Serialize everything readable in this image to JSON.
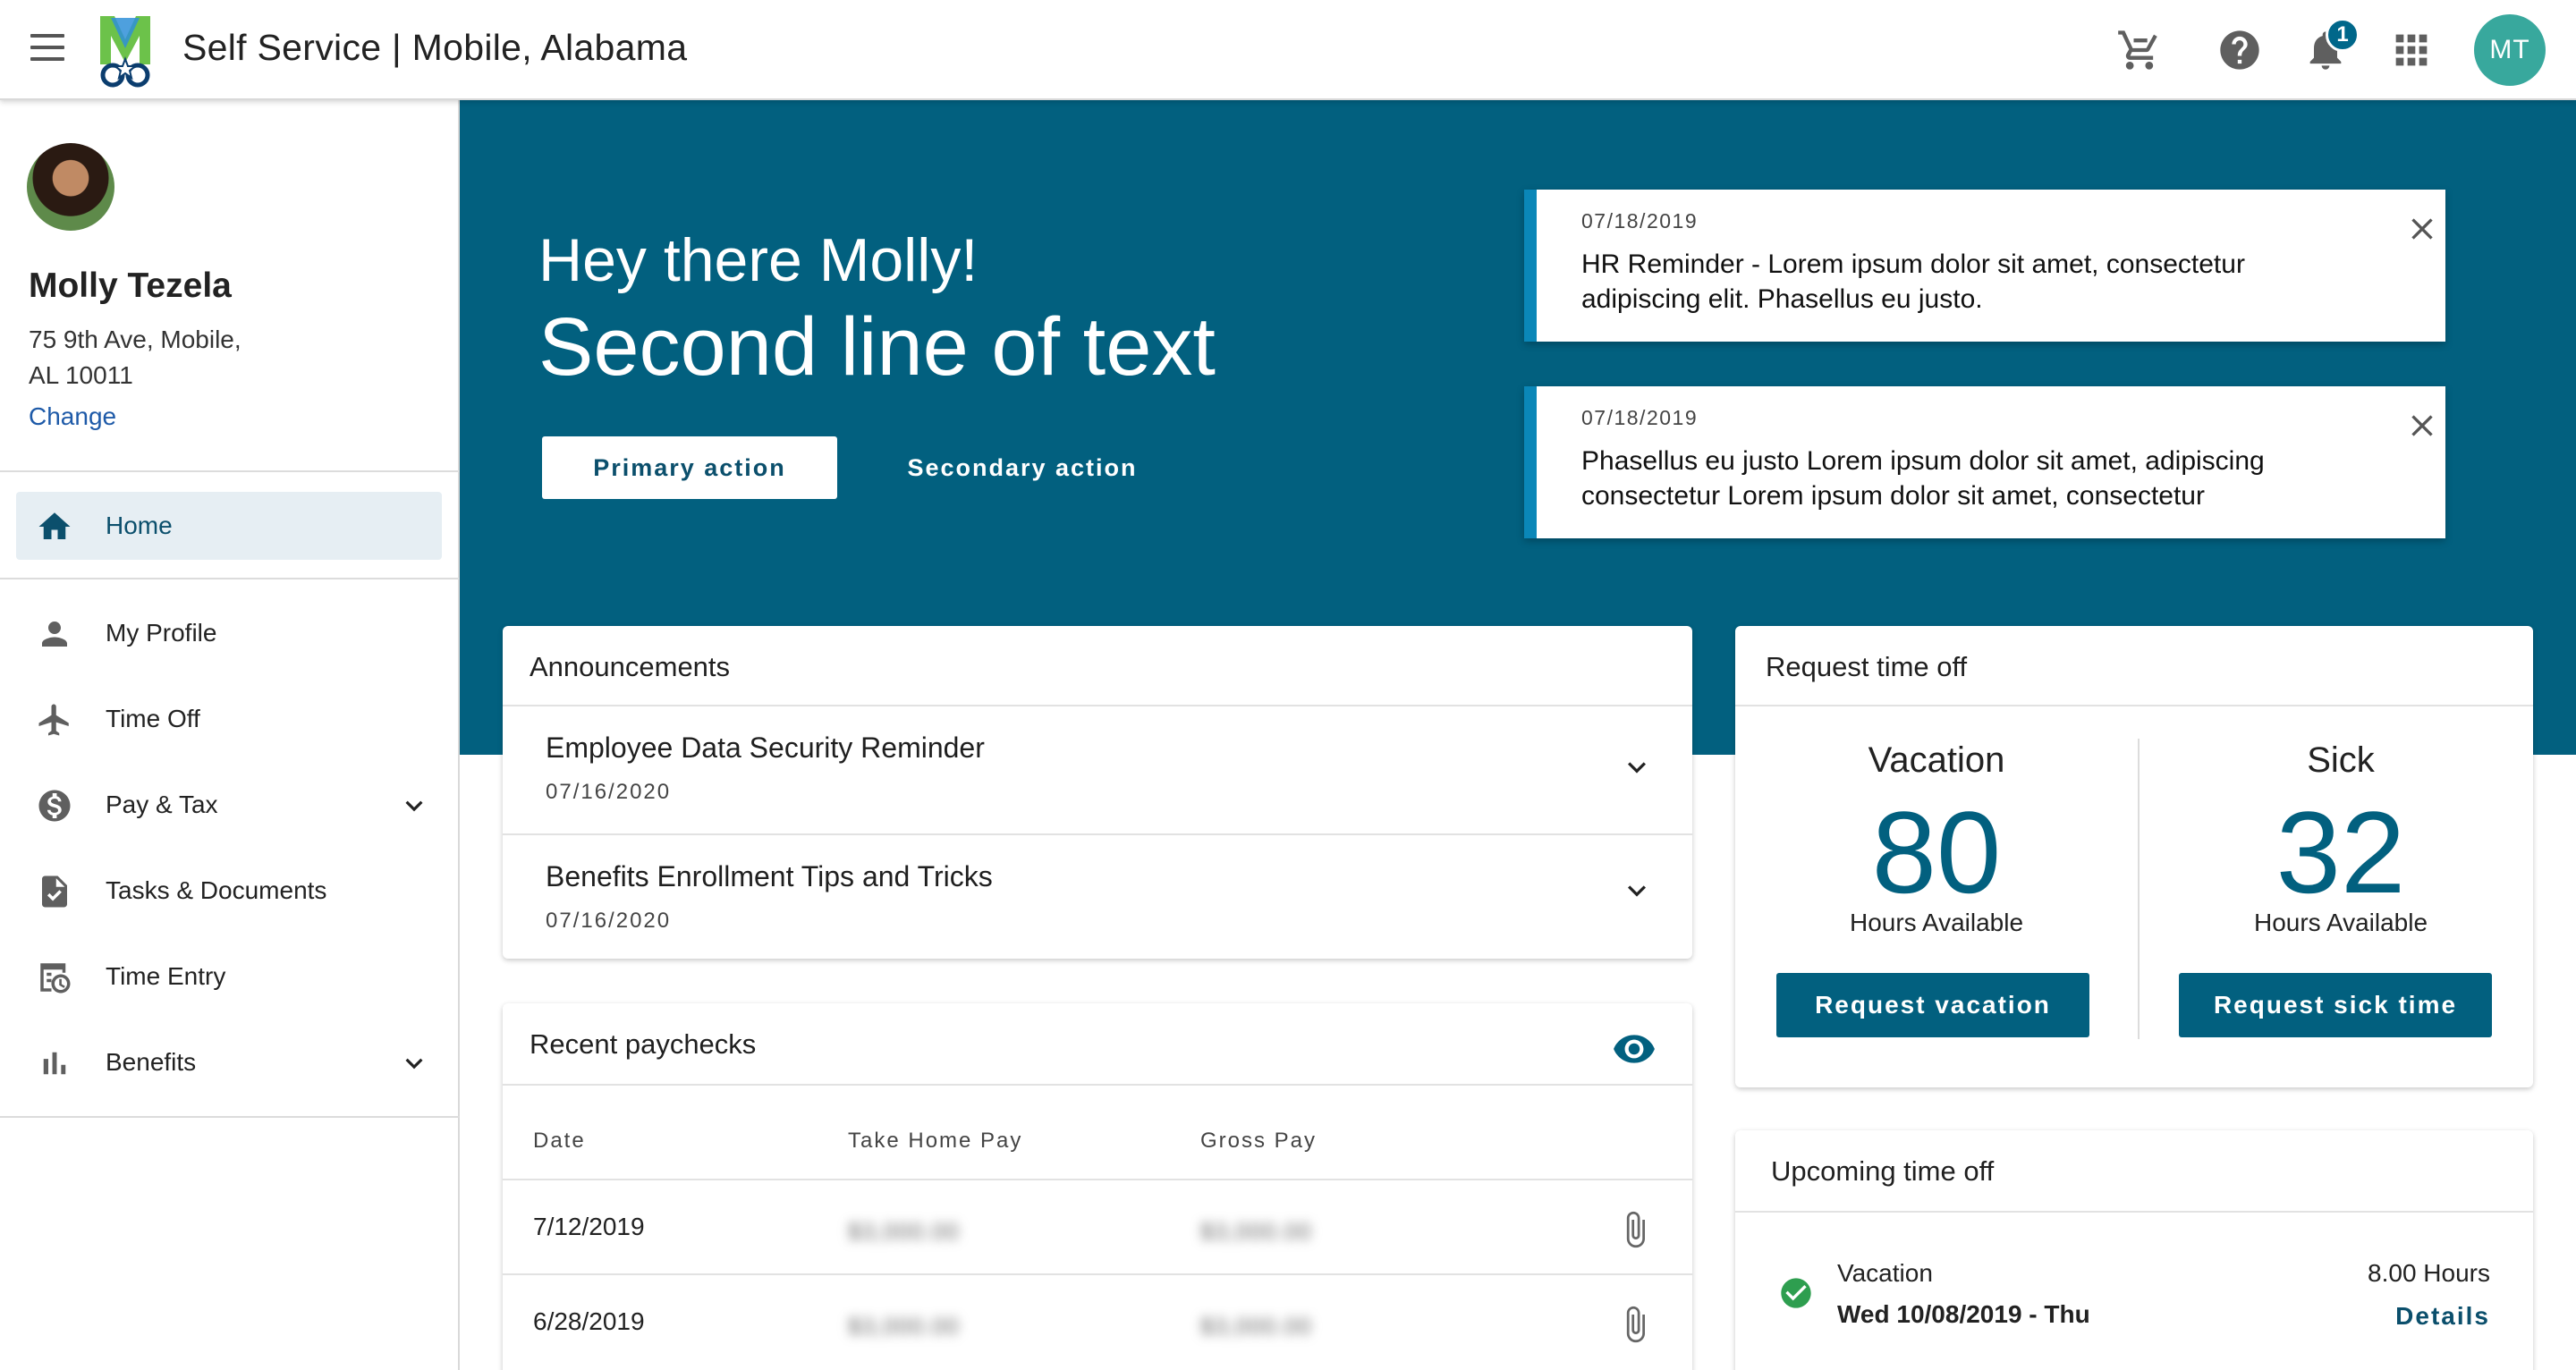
{
  "header": {
    "title": "Self Service | Mobile, Alabama",
    "notification_count": "1",
    "user_initials": "MT"
  },
  "colors": {
    "primary": "#02607f",
    "accent": "#0a87b8",
    "avatar": "#38a89d",
    "success": "#2e9e4f"
  },
  "profile": {
    "name": "Molly Tezela",
    "address_line1": "75 9th Ave, Mobile,",
    "address_line2": "AL 10011",
    "change_label": "Change"
  },
  "nav": {
    "items": [
      {
        "label": "Home",
        "icon": "home-icon"
      },
      {
        "label": "My Profile",
        "icon": "person-icon"
      },
      {
        "label": "Time Off",
        "icon": "airplane-icon"
      },
      {
        "label": "Pay & Tax",
        "icon": "dollar-icon"
      },
      {
        "label": "Tasks & Documents",
        "icon": "document-check-icon"
      },
      {
        "label": "Time Entry",
        "icon": "time-entry-icon"
      },
      {
        "label": "Benefits",
        "icon": "bar-chart-icon"
      }
    ]
  },
  "hero": {
    "greeting": "Hey there Molly!",
    "second_line": "Second line of text",
    "primary_action": "Primary action",
    "secondary_action": "Secondary action",
    "notices": [
      {
        "date": "07/18/2019",
        "text": "HR Reminder - Lorem ipsum dolor sit amet, consectetur adipiscing elit. Phasellus eu justo."
      },
      {
        "date": "07/18/2019",
        "text": "Phasellus eu justo Lorem ipsum dolor sit amet, adipiscing consectetur Lorem ipsum dolor sit amet, consectetur"
      }
    ]
  },
  "announcements": {
    "title": "Announcements",
    "items": [
      {
        "title": "Employee Data Security Reminder",
        "date": "07/16/2020"
      },
      {
        "title": "Benefits Enrollment Tips and Tricks",
        "date": "07/16/2020"
      }
    ]
  },
  "paychecks": {
    "title": "Recent paychecks",
    "columns": [
      "Date",
      "Take Home Pay",
      "Gross Pay"
    ],
    "rows": [
      {
        "date": "7/12/2019",
        "take_home": "$3,000.00",
        "gross": "$3,000.00"
      },
      {
        "date": "6/28/2019",
        "take_home": "$3,000.00",
        "gross": "$3,000.00"
      }
    ]
  },
  "time_off": {
    "title": "Request time off",
    "vacation": {
      "label": "Vacation",
      "hours": "80",
      "sub": "Hours Available",
      "button": "Request vacation"
    },
    "sick": {
      "label": "Sick",
      "hours": "32",
      "sub": "Hours Available",
      "button": "Request sick time"
    }
  },
  "upcoming": {
    "title": "Upcoming time off",
    "type": "Vacation",
    "date": "Wed 10/08/2019 - Thu",
    "hours": "8.00 Hours",
    "details_label": "Details"
  }
}
